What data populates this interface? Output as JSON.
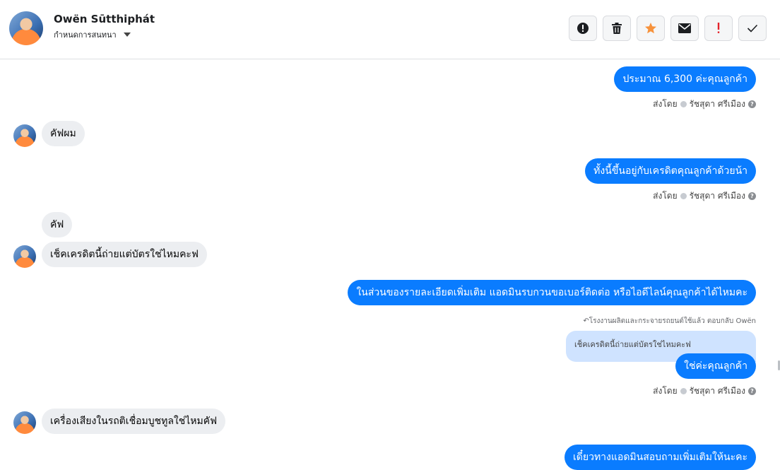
{
  "header": {
    "contact_name": "Owën Sūtthiphát",
    "assign_label": "กำหนดการสนทนา",
    "actions": [
      {
        "name": "spam-button",
        "icon": "alert-circle-icon"
      },
      {
        "name": "delete-button",
        "icon": "trash-icon"
      },
      {
        "name": "star-button",
        "icon": "star-icon",
        "color": "#f7923b"
      },
      {
        "name": "mark-unread-button",
        "icon": "envelope-icon"
      },
      {
        "name": "follow-up-button",
        "icon": "exclamation-icon",
        "color": "#e4232b"
      },
      {
        "name": "mark-done-button",
        "icon": "check-icon"
      }
    ]
  },
  "messages": {
    "m1": "ประมาณ 6,300  ค่ะคุณลูกค้า",
    "m2": "คัฟผม",
    "m3": "ทั้งนี้ขึ้นอยู่กับเครดิตคุณลูกค้าด้วยน้า",
    "m4": "คัฟ",
    "m5": "เช็คเครดิตนี้ถ่ายแต่บัตรใช่ไหมคะฟ",
    "m6": "ในส่วนของรายละเอียดเพิ่มเติม แอดมินรบกวนขอเบอร์ติดต่อ หรือไอดีไลน์คุณลูกค้าได้ไหมคะ",
    "reply_label": "↶โรงงานผลิตและกระจายรถยนต์ใช้แล้ว ตอบกลับ Owën",
    "quoted": "เช็คเครดิตนี้ถ่ายแต่บัตรใช่ไหมคะฟ",
    "m7": "ใช่ค่ะคุณลูกค้า",
    "m8": "เครื่องเสียงในรถติเชื่อมบูชทูลใช่ไหมคัฟ",
    "m9": "เดี๋ยวทางแอดมินสอบถามเพิ่มเติมให้นะคะ"
  },
  "sent_by": {
    "prefix": "ส่งโดย",
    "agent": "รัชสุดา ศรีเมือง",
    "help": "?"
  },
  "colors": {
    "outgoing": "#0a7cff",
    "incoming": "#eceef1",
    "quoted": "#cfe3ff"
  }
}
